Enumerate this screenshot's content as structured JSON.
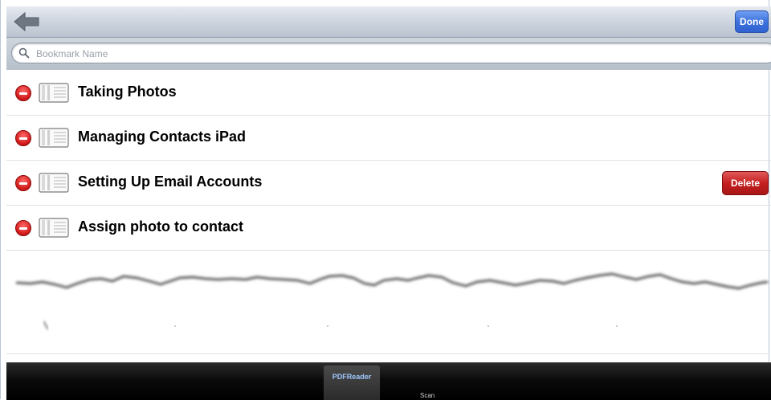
{
  "toolbar": {
    "back_icon": "back-arrow-icon",
    "done_label": "Done"
  },
  "search": {
    "placeholder": "Bookmark Name",
    "value": "",
    "icon": "search-icon"
  },
  "bookmarks": [
    {
      "label": "Taking Photos",
      "show_delete": false
    },
    {
      "label": "Managing Contacts iPad",
      "show_delete": false
    },
    {
      "label": "Setting Up Email Accounts",
      "show_delete": true
    },
    {
      "label": "Assign photo to contact",
      "show_delete": false
    }
  ],
  "row_actions": {
    "delete_label": "Delete",
    "remove_icon": "minus-circle-icon",
    "bookmark_icon": "book-icon"
  },
  "bottom_bar": {
    "tabs": [
      {
        "label": "PDFReader"
      },
      {
        "label": "Scan"
      }
    ]
  },
  "colors": {
    "done_button": "#3d72dd",
    "delete_button": "#c51f1f",
    "remove_icon": "#d01616"
  }
}
